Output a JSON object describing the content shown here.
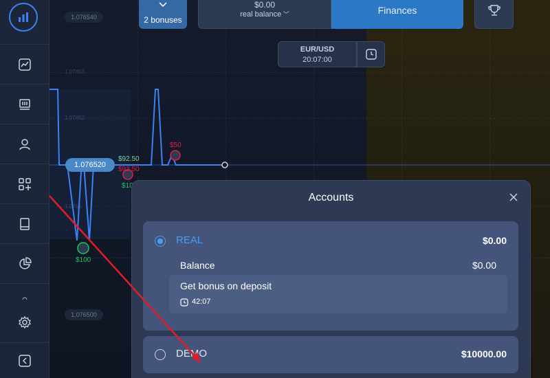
{
  "sidebar": {
    "items": [
      {
        "icon": "chart-icon"
      },
      {
        "icon": "trades-icon"
      },
      {
        "icon": "user-icon"
      },
      {
        "icon": "apps-icon"
      },
      {
        "icon": "book-icon"
      },
      {
        "icon": "pie-chart-icon"
      },
      {
        "icon": "more-icon"
      },
      {
        "icon": "gear-icon"
      },
      {
        "icon": "collapse-icon"
      }
    ]
  },
  "header": {
    "bonuses_label": "2 bonuses",
    "balance_amount": "$0.00",
    "balance_type": "real balance",
    "finances_label": "Finances"
  },
  "asset": {
    "pair": "EUR/USD",
    "time": "20:07:00"
  },
  "chart": {
    "price_top": "1.076540",
    "price_bottom": "1.076500",
    "faint_1": "1.07653",
    "faint_2": "1.07652",
    "faint_3": "1.0765",
    "current_price": "1.076520",
    "deals": {
      "d1_amount": "$92.50",
      "d1_lose": "$92.50",
      "d1_stake": "$100",
      "d2_amount": "$50",
      "d3_stake": "$100"
    }
  },
  "modal": {
    "title": "Accounts",
    "real": {
      "name": "REAL",
      "amount": "$0.00",
      "balance_label": "Balance",
      "balance_value": "$0.00",
      "bonus_title": "Get bonus on deposit",
      "bonus_timer": "42:07"
    },
    "demo": {
      "name": "DEMO",
      "amount": "$10000.00"
    }
  },
  "colors": {
    "accent": "#3b82f6",
    "sidebar": "#1d2638",
    "modal": "#2e3a54",
    "card": "#44547a",
    "annotation": "#e11d28"
  }
}
